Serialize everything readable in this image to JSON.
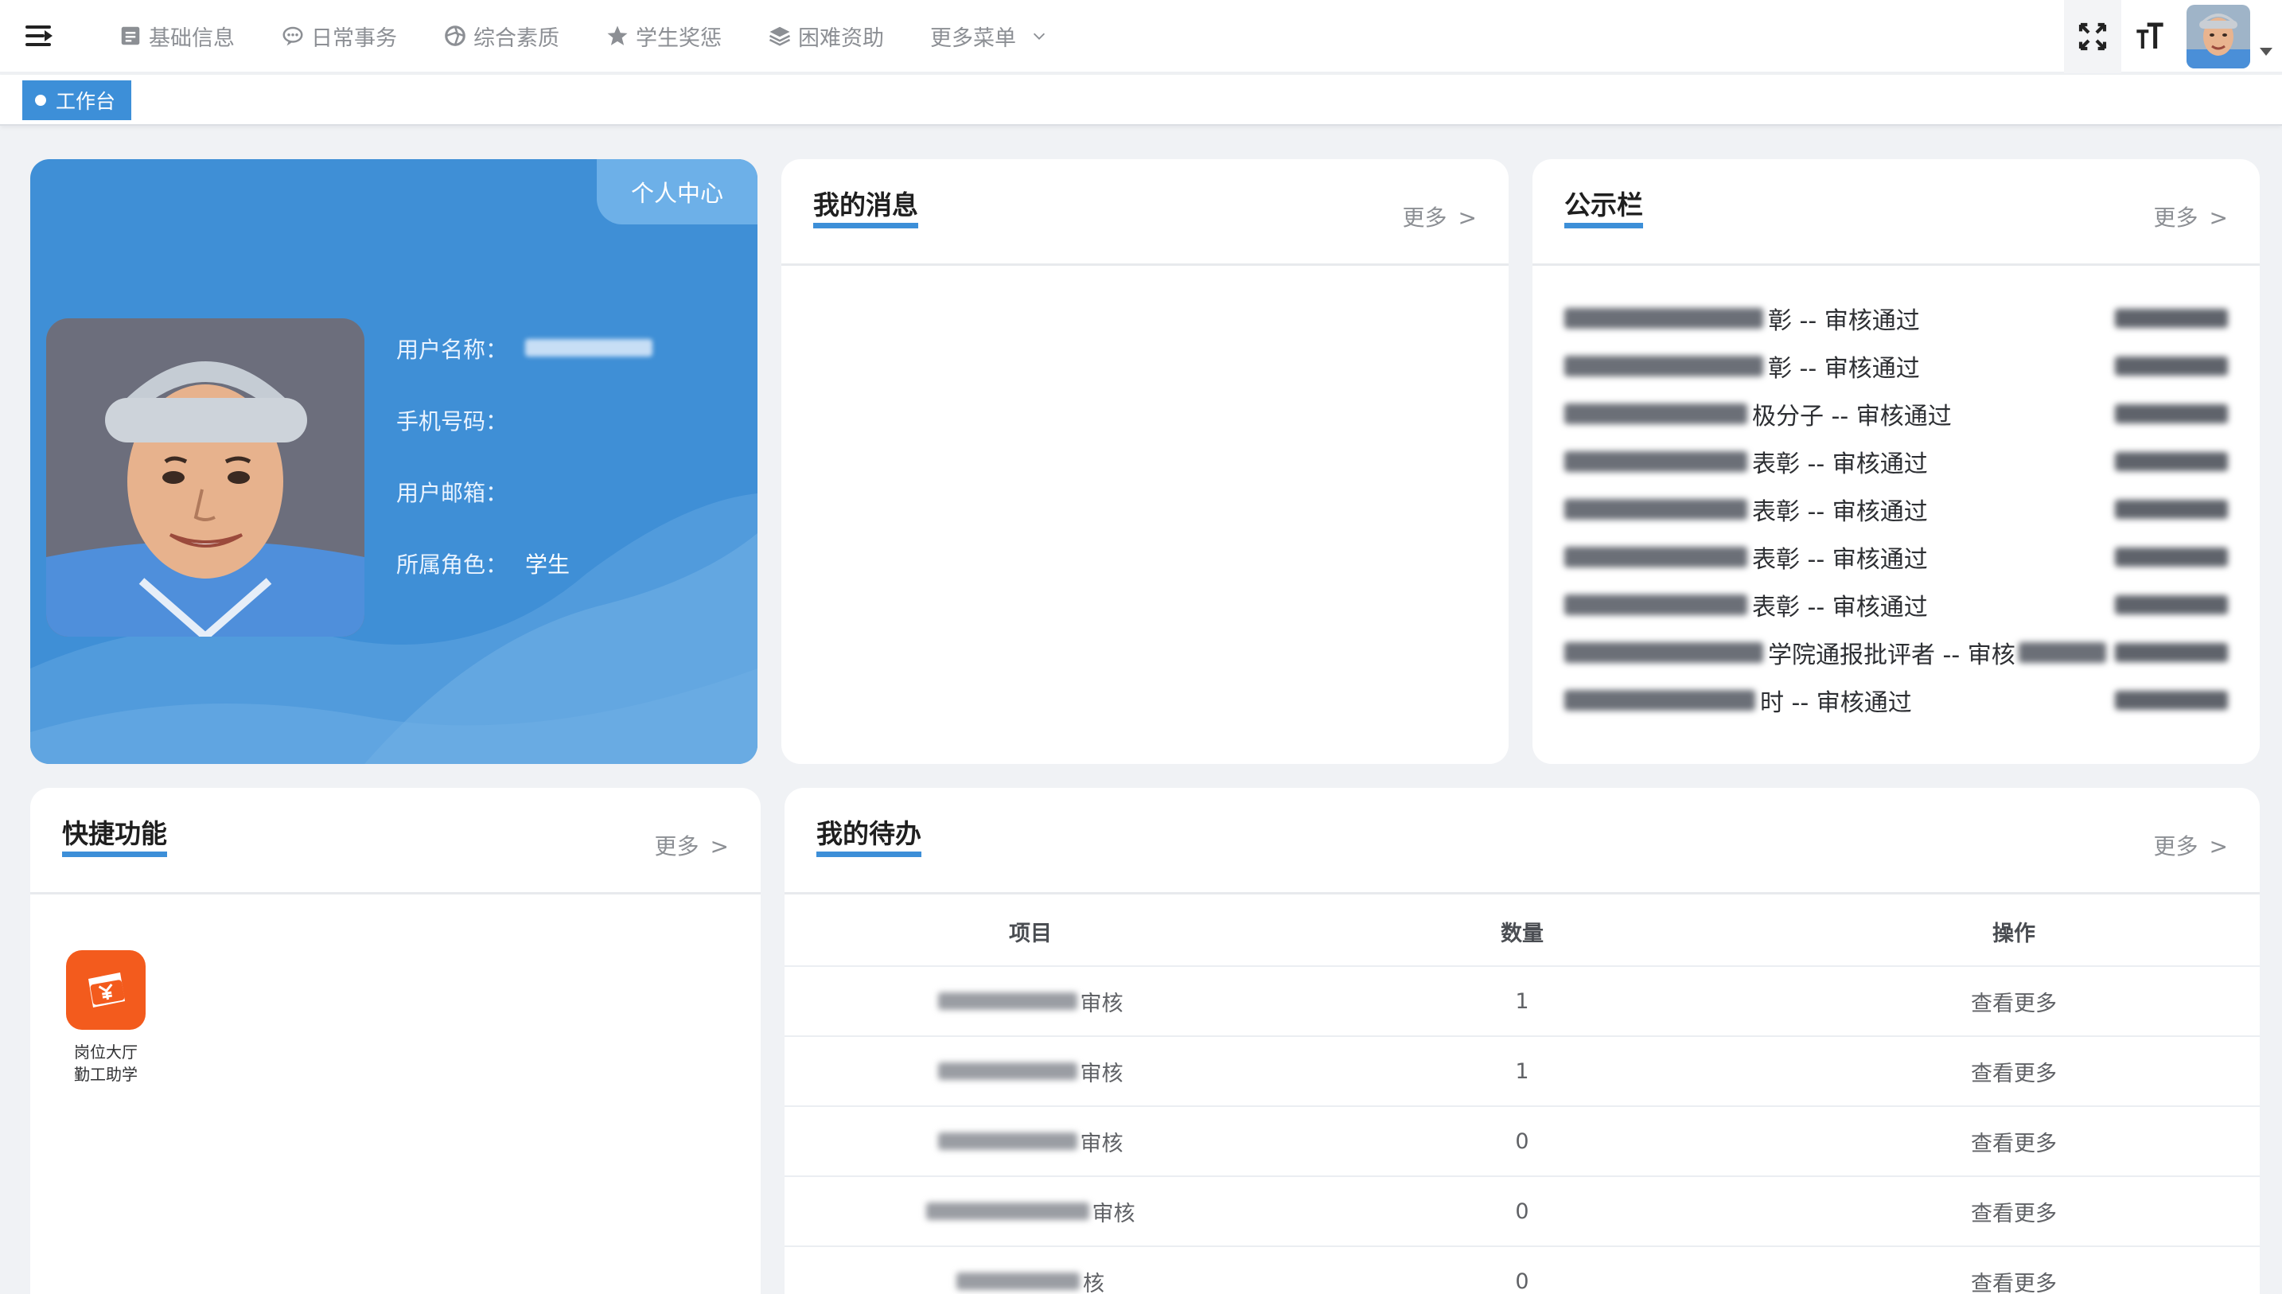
{
  "navbar": {
    "menu": [
      {
        "label": "基础信息",
        "icon": "document-icon"
      },
      {
        "label": "日常事务",
        "icon": "chat-icon"
      },
      {
        "label": "综合素质",
        "icon": "aperture-icon"
      },
      {
        "label": "学生奖惩",
        "icon": "star-icon"
      },
      {
        "label": "困难资助",
        "icon": "layers-icon"
      },
      {
        "label": "更多菜单",
        "icon": "chevron-down-icon"
      }
    ]
  },
  "tags": {
    "active": "工作台"
  },
  "profile": {
    "tab_label": "个人中心",
    "username_label": "用户名称：",
    "phone_label": "手机号码：",
    "email_label": "用户邮箱：",
    "role_label": "所属角色：",
    "role_value": "学生"
  },
  "messages": {
    "title": "我的消息",
    "more": "更多",
    "more_arrow": ">"
  },
  "notices": {
    "title": "公示栏",
    "more": "更多",
    "more_arrow": ">",
    "items": [
      {
        "suffix": "彰 -- 审核通过"
      },
      {
        "suffix": "彰 -- 审核通过"
      },
      {
        "suffix": "极分子 -- 审核通过"
      },
      {
        "suffix": "表彰 -- 审核通过"
      },
      {
        "suffix": "表彰 -- 审核通过"
      },
      {
        "suffix": "表彰 -- 审核通过"
      },
      {
        "suffix": "表彰 -- 审核通过"
      },
      {
        "suffix": "学院通报批评者 -- 审核"
      },
      {
        "suffix": "时 -- 审核通过"
      }
    ]
  },
  "quick": {
    "title": "快捷功能",
    "more": "更多",
    "more_arrow": ">",
    "items": [
      {
        "line1": "岗位大厅",
        "line2": "勤工助学",
        "icon": "ticket-icon"
      }
    ]
  },
  "todo": {
    "title": "我的待办",
    "more": "更多",
    "more_arrow": ">",
    "headers": {
      "item": "项目",
      "count": "数量",
      "action": "操作"
    },
    "rows": [
      {
        "suffix": "审核",
        "count": "1",
        "action": "查看更多"
      },
      {
        "suffix": "审核",
        "count": "1",
        "action": "查看更多"
      },
      {
        "suffix": "审核",
        "count": "0",
        "action": "查看更多"
      },
      {
        "suffix": "审核",
        "count": "0",
        "action": "查看更多"
      },
      {
        "suffix": "核",
        "count": "0",
        "action": "查看更多"
      }
    ]
  },
  "colors": {
    "primary": "#3d8fd8",
    "profile_bg": "#3f8fd6",
    "quick_icon": "#f35b1d"
  }
}
